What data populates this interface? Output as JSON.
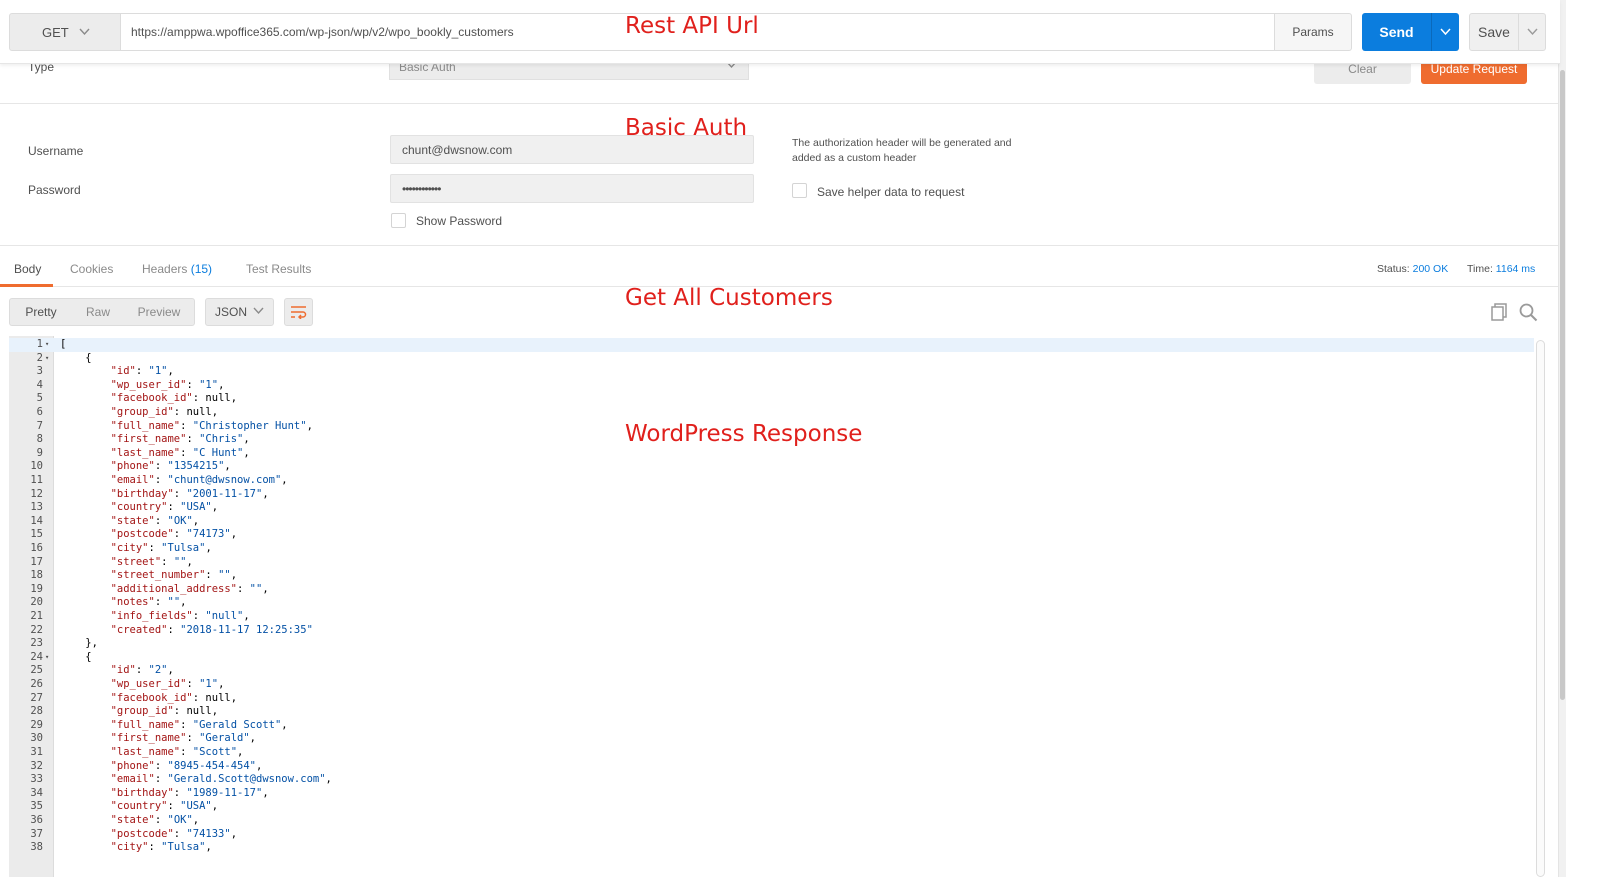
{
  "request": {
    "method": "GET",
    "url": "https://amppwa.wpoffice365.com/wp-json/wp/v2/wpo_bookly_customers",
    "params_label": "Params",
    "send_label": "Send",
    "save_label": "Save"
  },
  "auth": {
    "type_label": "Type",
    "type_value": "Basic Auth",
    "clear_label": "Clear",
    "update_label": "Update Request",
    "username_label": "Username",
    "username_value": "chunt@dwsnow.com",
    "password_label": "Password",
    "password_value": "••••••••••••",
    "show_password_label": "Show Password",
    "note": "The authorization header will be generated and added as a custom header",
    "save_helper_label": "Save helper data to request"
  },
  "response": {
    "tabs": {
      "body": "Body",
      "cookies": "Cookies",
      "headers": "Headers",
      "headers_count": "(15)",
      "test_results": "Test Results"
    },
    "status_label": "Status:",
    "status_value": "200 OK",
    "time_label": "Time:",
    "time_value": "1164 ms"
  },
  "viewer": {
    "modes": [
      "Pretty",
      "Raw",
      "Preview"
    ],
    "active_mode": "Pretty",
    "format": "JSON"
  },
  "code_lines": [
    {
      "n": "1",
      "fold": true,
      "text": "["
    },
    {
      "n": "2",
      "fold": true,
      "text": "    {"
    },
    {
      "n": "3",
      "key": "id",
      "val": "\"1\"",
      "sep": ","
    },
    {
      "n": "4",
      "key": "wp_user_id",
      "val": "\"1\"",
      "sep": ","
    },
    {
      "n": "5",
      "key": "facebook_id",
      "val": "null",
      "sep": ","
    },
    {
      "n": "6",
      "key": "group_id",
      "val": "null",
      "sep": ","
    },
    {
      "n": "7",
      "key": "full_name",
      "val": "\"Christopher Hunt\"",
      "sep": ","
    },
    {
      "n": "8",
      "key": "first_name",
      "val": "\"Chris\"",
      "sep": ","
    },
    {
      "n": "9",
      "key": "last_name",
      "val": "\"C Hunt\"",
      "sep": ","
    },
    {
      "n": "10",
      "key": "phone",
      "val": "\"1354215\"",
      "sep": ","
    },
    {
      "n": "11",
      "key": "email",
      "val": "\"chunt@dwsnow.com\"",
      "sep": ","
    },
    {
      "n": "12",
      "key": "birthday",
      "val": "\"2001-11-17\"",
      "sep": ","
    },
    {
      "n": "13",
      "key": "country",
      "val": "\"USA\"",
      "sep": ","
    },
    {
      "n": "14",
      "key": "state",
      "val": "\"OK\"",
      "sep": ","
    },
    {
      "n": "15",
      "key": "postcode",
      "val": "\"74173\"",
      "sep": ","
    },
    {
      "n": "16",
      "key": "city",
      "val": "\"Tulsa\"",
      "sep": ","
    },
    {
      "n": "17",
      "key": "street",
      "val": "\"\"",
      "sep": ","
    },
    {
      "n": "18",
      "key": "street_number",
      "val": "\"\"",
      "sep": ","
    },
    {
      "n": "19",
      "key": "additional_address",
      "val": "\"\"",
      "sep": ","
    },
    {
      "n": "20",
      "key": "notes",
      "val": "\"\"",
      "sep": ","
    },
    {
      "n": "21",
      "key": "info_fields",
      "val": "\"null\"",
      "sep": ","
    },
    {
      "n": "22",
      "key": "created",
      "val": "\"2018-11-17 12:25:35\"",
      "sep": ""
    },
    {
      "n": "23",
      "text": "    },"
    },
    {
      "n": "24",
      "fold": true,
      "text": "    {"
    },
    {
      "n": "25",
      "key": "id",
      "val": "\"2\"",
      "sep": ","
    },
    {
      "n": "26",
      "key": "wp_user_id",
      "val": "\"1\"",
      "sep": ","
    },
    {
      "n": "27",
      "key": "facebook_id",
      "val": "null",
      "sep": ","
    },
    {
      "n": "28",
      "key": "group_id",
      "val": "null",
      "sep": ","
    },
    {
      "n": "29",
      "key": "full_name",
      "val": "\"Gerald Scott\"",
      "sep": ","
    },
    {
      "n": "30",
      "key": "first_name",
      "val": "\"Gerald\"",
      "sep": ","
    },
    {
      "n": "31",
      "key": "last_name",
      "val": "\"Scott\"",
      "sep": ","
    },
    {
      "n": "32",
      "key": "phone",
      "val": "\"8945-454-454\"",
      "sep": ","
    },
    {
      "n": "33",
      "key": "email",
      "val": "\"Gerald.Scott@dwsnow.com\"",
      "sep": ","
    },
    {
      "n": "34",
      "key": "birthday",
      "val": "\"1989-11-17\"",
      "sep": ","
    },
    {
      "n": "35",
      "key": "country",
      "val": "\"USA\"",
      "sep": ","
    },
    {
      "n": "36",
      "key": "state",
      "val": "\"OK\"",
      "sep": ","
    },
    {
      "n": "37",
      "key": "postcode",
      "val": "\"74133\"",
      "sep": ","
    },
    {
      "n": "38",
      "key": "city",
      "val": "\"Tulsa\"",
      "sep": ","
    }
  ],
  "annotations": {
    "rest_api_url": "Rest API Url",
    "basic_auth": "Basic Auth",
    "get_all_customers": "Get All Customers",
    "wordpress_response": "WordPress Response"
  },
  "colors": {
    "accent_blue": "#0b7dde",
    "accent_orange": "#ef6c2f",
    "annotation_red": "#e0201c"
  }
}
